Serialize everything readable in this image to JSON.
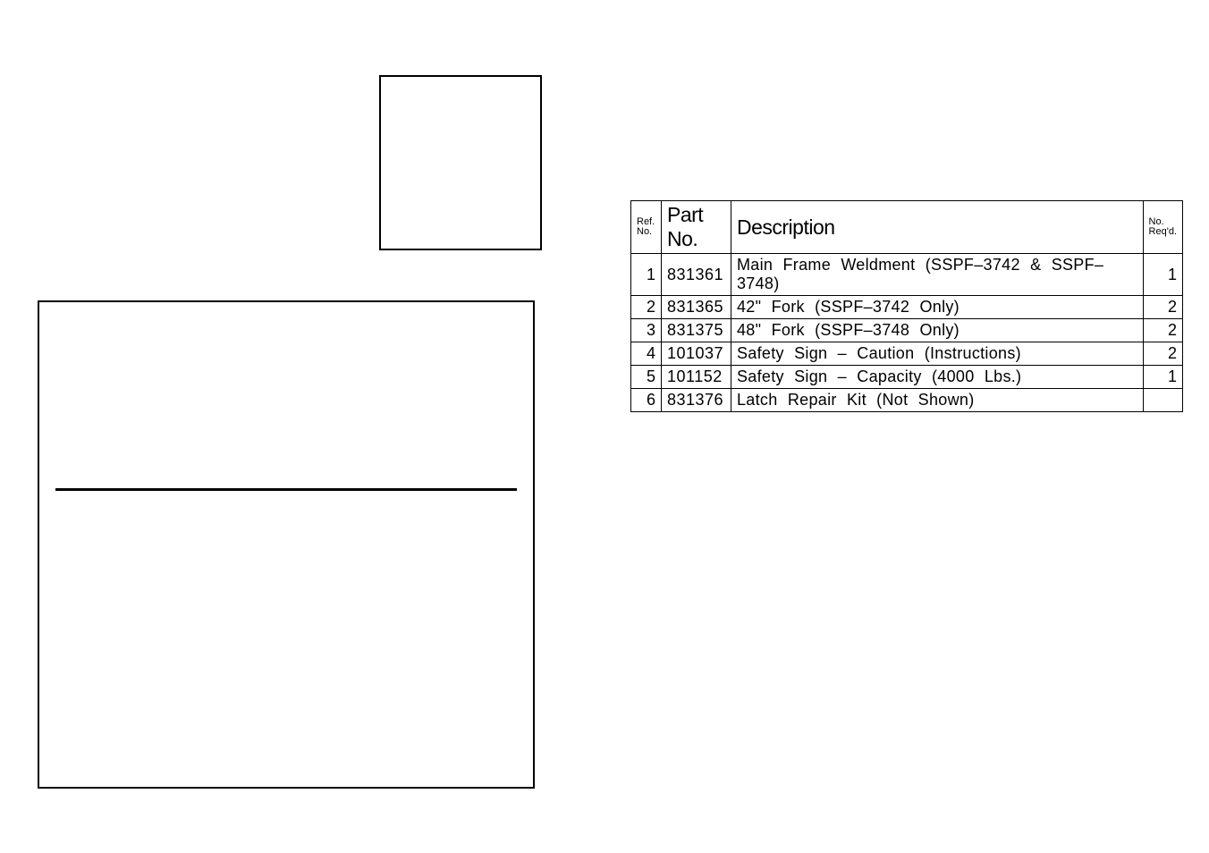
{
  "headers": {
    "ref": "Ref.\nNo.",
    "part": "Part No.",
    "desc": "Description",
    "req": "No.\nReq'd."
  },
  "rows": [
    {
      "ref": "1",
      "part": "831361",
      "desc": "Main Frame Weldment (SSPF–3742 & SSPF–3748)",
      "req": "1"
    },
    {
      "ref": "2",
      "part": "831365",
      "desc": "42\" Fork (SSPF–3742 Only)",
      "req": "2"
    },
    {
      "ref": "3",
      "part": "831375",
      "desc": "48\" Fork (SSPF–3748 Only)",
      "req": "2"
    },
    {
      "ref": "4",
      "part": "101037",
      "desc": "Safety Sign – Caution (Instructions)",
      "req": "2"
    },
    {
      "ref": "5",
      "part": "101152",
      "desc": "Safety Sign – Capacity (4000 Lbs.)",
      "req": "1"
    },
    {
      "ref": "6",
      "part": "831376",
      "desc": "Latch Repair Kit  (Not Shown)",
      "req": ""
    }
  ]
}
